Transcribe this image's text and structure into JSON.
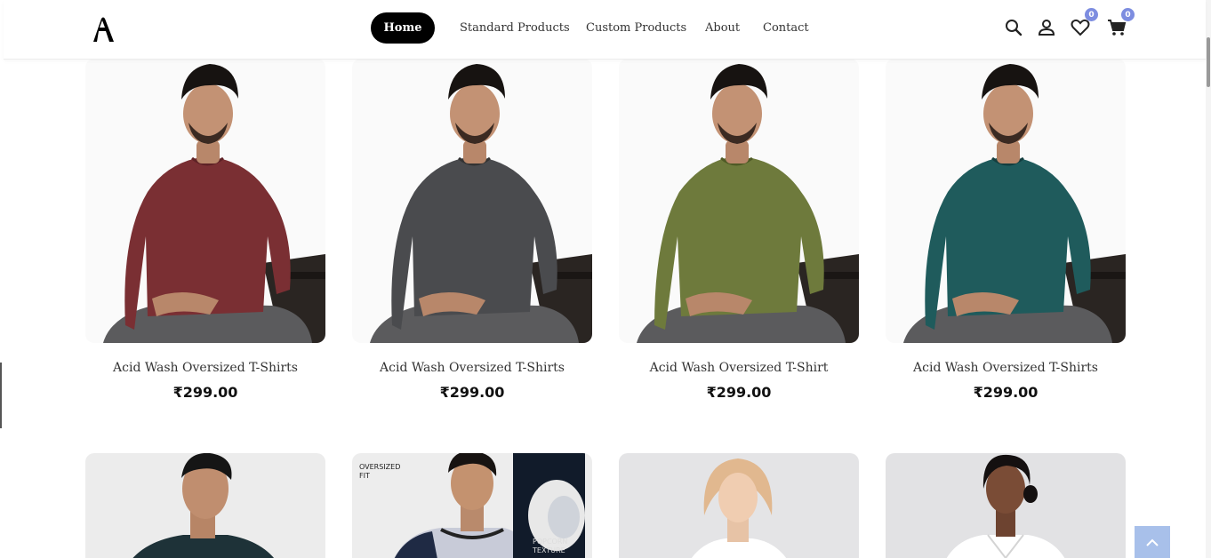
{
  "header": {
    "logo_alt": "A",
    "nav": {
      "home": "Home",
      "standard": "Standard Products",
      "custom": "Custom Products",
      "about": "About",
      "contact": "Contact"
    },
    "icons": [
      "search-icon",
      "user-icon",
      "heart-icon",
      "cart-icon"
    ],
    "wishlist_count": "0",
    "cart_count": "0"
  },
  "products_row1": [
    {
      "title": "Acid Wash Oversized T-Shirts",
      "price": "₹299.00",
      "shirt_color": "#7a2f33"
    },
    {
      "title": "Acid Wash Oversized T-Shirts",
      "price": "₹299.00",
      "shirt_color": "#4a4b4e"
    },
    {
      "title": "Acid Wash Oversized T-Shirt",
      "price": "₹299.00",
      "shirt_color": "#6e7a3c"
    },
    {
      "title": "Acid Wash Oversized T-Shirts",
      "price": "₹299.00",
      "shirt_color": "#1f5b5c"
    }
  ],
  "products_row2": [
    {
      "kind": "man-dark-tee"
    },
    {
      "kind": "oversized-popcorn",
      "tag_top_1": "OVERSIZED",
      "tag_top_2": "FIT",
      "tag_bottom_1": "POPCORN",
      "tag_bottom_2": "TEXTURE"
    },
    {
      "kind": "woman-blonde"
    },
    {
      "kind": "woman-white-shirt"
    }
  ],
  "colors": {
    "accent_badge": "#7d8de0",
    "back_to_top": "#a8c0ea"
  }
}
